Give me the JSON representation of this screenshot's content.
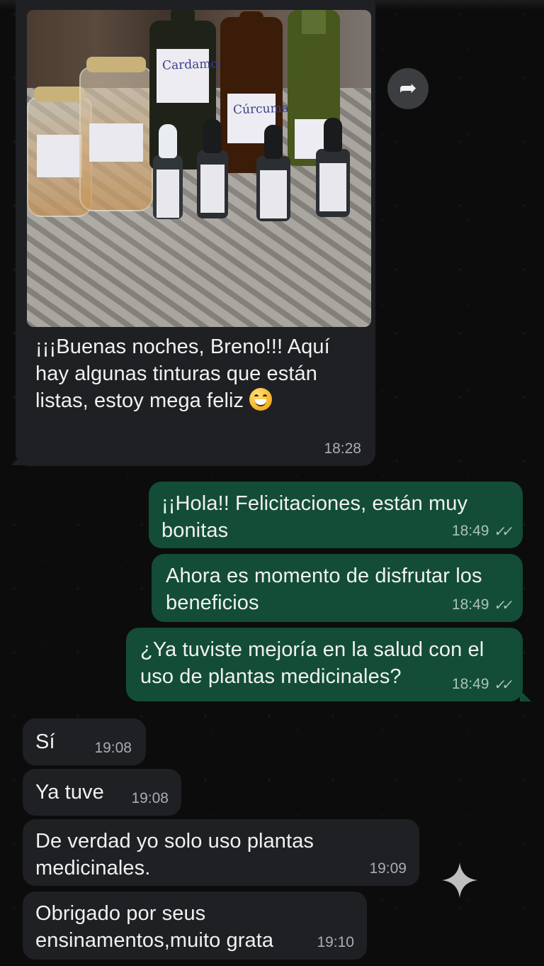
{
  "messages": [
    {
      "id": "photo-message",
      "direction": "incoming",
      "has_photo": true,
      "text": "¡¡¡Buenas noches, Breno!!! Aquí hay algunas tinturas que están listas, estoy mega feliz",
      "time": "18:28",
      "photo_labels": [
        "Cardamomo",
        "Cúrcuma"
      ]
    },
    {
      "id": "msg-2",
      "direction": "outgoing",
      "text": "¡¡Hola!! Felicitaciones, están muy bonitas",
      "time": "18:49",
      "status": "read"
    },
    {
      "id": "msg-3",
      "direction": "outgoing",
      "text": "Ahora es momento de disfrutar los beneficios",
      "time": "18:49",
      "status": "read"
    },
    {
      "id": "msg-4",
      "direction": "outgoing",
      "text": "¿Ya tuviste mejoría en la salud con el uso de plantas medicinales?",
      "time": "18:49",
      "status": "read"
    },
    {
      "id": "msg-5",
      "direction": "incoming",
      "text": "Sí",
      "time": "19:08"
    },
    {
      "id": "msg-6",
      "direction": "incoming",
      "text": "Ya tuve",
      "time": "19:08"
    },
    {
      "id": "msg-7",
      "direction": "incoming",
      "text": "De verdad yo solo uso plantas medicinales.",
      "time": "19:09"
    },
    {
      "id": "msg-8",
      "direction": "incoming",
      "text": "Obrigado por seus ensinamentos,muito grata",
      "time": "19:10"
    }
  ],
  "icons": {
    "forward": "forward-icon",
    "read_receipt": "double-check-icon",
    "emoji": "grinning-face-icon",
    "sparkle": "sparkle-icon"
  },
  "colors": {
    "background": "#0c0c0c",
    "incoming_bubble": "#1f2023",
    "outgoing_bubble": "#134d37",
    "timestamp": "#a9adb1"
  }
}
